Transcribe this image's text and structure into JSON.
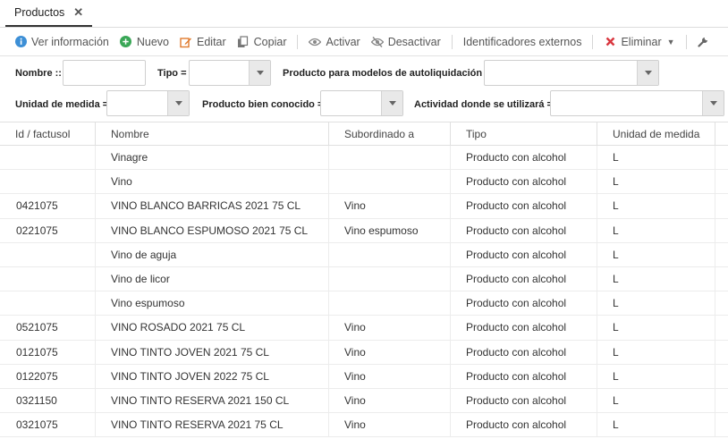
{
  "tab": {
    "label": "Productos"
  },
  "toolbar": {
    "ver_informacion": "Ver información",
    "nuevo": "Nuevo",
    "editar": "Editar",
    "copiar": "Copiar",
    "activar": "Activar",
    "desactivar": "Desactivar",
    "identificadores": "Identificadores externos",
    "eliminar": "Eliminar"
  },
  "filters": {
    "nombre": "Nombre ::",
    "tipo": "Tipo =",
    "autoliquidacion": "Producto para modelos de autoliquidación =",
    "unidad": "Unidad de medida =",
    "bien_conocido": "Producto bien conocido =",
    "actividad": "Actividad donde se utilizará ="
  },
  "grid": {
    "headers": [
      "Id / factusol",
      "Nombre",
      "Subordinado a",
      "Tipo",
      "Unidad de medida"
    ],
    "rows": [
      [
        "",
        "Vinagre",
        "",
        "Producto con alcohol",
        "L"
      ],
      [
        "",
        "Vino",
        "",
        "Producto con alcohol",
        "L"
      ],
      [
        "0421075",
        "VINO BLANCO BARRICAS 2021 75 CL",
        "Vino",
        "Producto con alcohol",
        "L"
      ],
      [
        "0221075",
        "VINO BLANCO ESPUMOSO 2021 75 CL",
        "Vino espumoso",
        "Producto con alcohol",
        "L"
      ],
      [
        "",
        "Vino de aguja",
        "",
        "Producto con alcohol",
        "L"
      ],
      [
        "",
        "Vino de licor",
        "",
        "Producto con alcohol",
        "L"
      ],
      [
        "",
        "Vino espumoso",
        "",
        "Producto con alcohol",
        "L"
      ],
      [
        "0521075",
        "VINO ROSADO 2021 75 CL",
        "Vino",
        "Producto con alcohol",
        "L"
      ],
      [
        "0121075",
        "VINO TINTO JOVEN 2021 75 CL",
        "Vino",
        "Producto con alcohol",
        "L"
      ],
      [
        "0122075",
        "VINO TINTO JOVEN 2022 75 CL",
        "Vino",
        "Producto con alcohol",
        "L"
      ],
      [
        "0321150",
        "VINO TINTO RESERVA 2021 150 CL",
        "Vino",
        "Producto con alcohol",
        "L"
      ],
      [
        "0321075",
        "VINO TINTO RESERVA 2021 75 CL",
        "Vino",
        "Producto con alcohol",
        "L"
      ]
    ]
  },
  "colors": {
    "info": "#3d8fd6",
    "nuevo": "#3aa757",
    "editar": "#e07b2d",
    "eliminar": "#d9363e"
  },
  "icons": [
    "info-icon",
    "plus-circle-icon",
    "edit-icon",
    "copy-icon",
    "eye-icon",
    "eye-slash-icon",
    "close-x-icon",
    "wrench-icon"
  ]
}
